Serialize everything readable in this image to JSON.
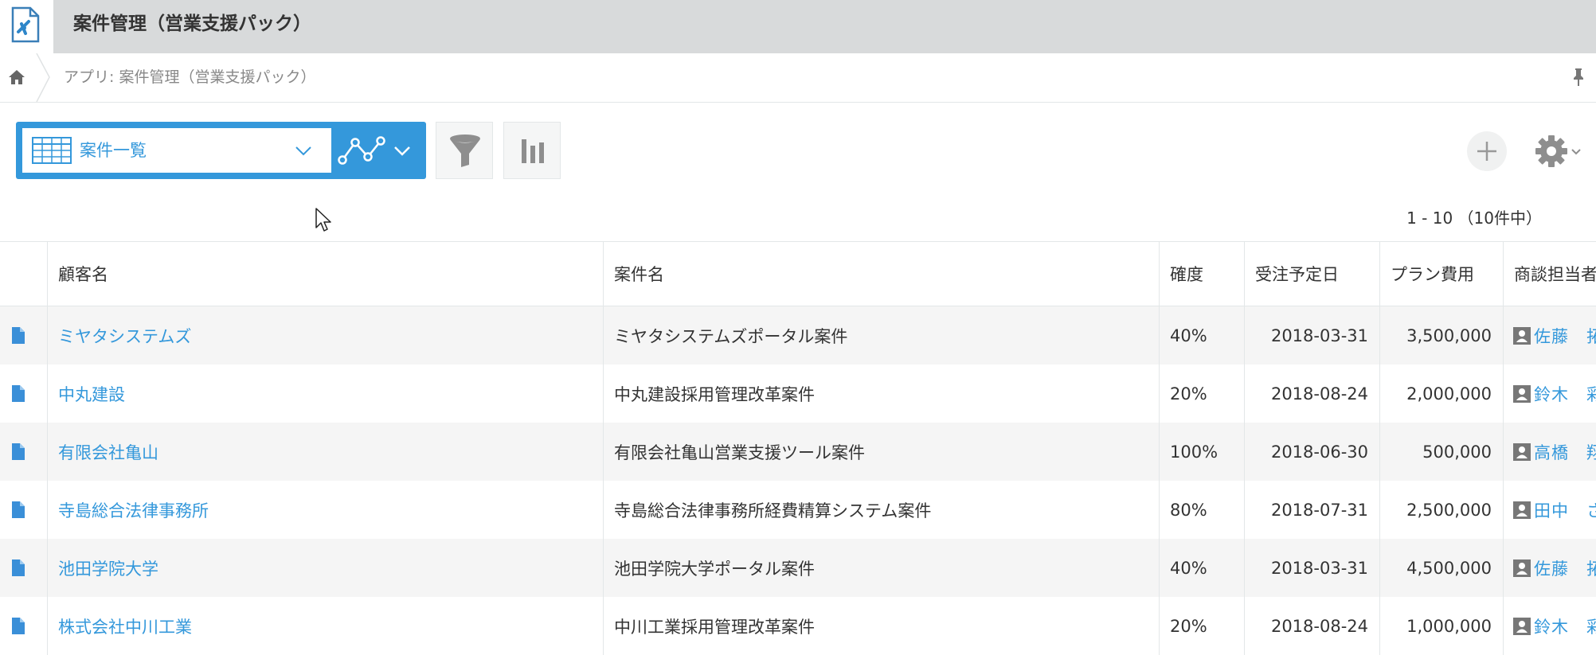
{
  "app": {
    "title": "案件管理（営業支援パック）"
  },
  "breadcrumb": {
    "text": "アプリ: 案件管理（営業支援パック）"
  },
  "toolbar": {
    "view_name": "案件一覧",
    "pagination": "1 - 10 （10件中）"
  },
  "table": {
    "headers": {
      "customer": "顧客名",
      "project": "案件名",
      "probability": "確度",
      "date": "受注予定日",
      "cost": "プラン費用",
      "owner": "商談担当者"
    },
    "rows": [
      {
        "customer": "ミヤタシステムズ",
        "project": "ミヤタシステムズポータル案件",
        "probability": "40%",
        "date": "2018-03-31",
        "cost": "3,500,000",
        "owner": "佐藤　拓哉"
      },
      {
        "customer": "中丸建設",
        "project": "中丸建設採用管理改革案件",
        "probability": "20%",
        "date": "2018-08-24",
        "cost": "2,000,000",
        "owner": "鈴木　彩"
      },
      {
        "customer": "有限会社亀山",
        "project": "有限会社亀山営業支援ツール案件",
        "probability": "100%",
        "date": "2018-06-30",
        "cost": "500,000",
        "owner": "高橋　翔太"
      },
      {
        "customer": "寺島総合法律事務所",
        "project": "寺島総合法律事務所経費精算システム案件",
        "probability": "80%",
        "date": "2018-07-31",
        "cost": "2,500,000",
        "owner": "田中　さくら"
      },
      {
        "customer": "池田学院大学",
        "project": "池田学院大学ポータル案件",
        "probability": "40%",
        "date": "2018-03-31",
        "cost": "4,500,000",
        "owner": "佐藤　拓哉"
      },
      {
        "customer": "株式会社中川工業",
        "project": "中川工業採用管理改革案件",
        "probability": "20%",
        "date": "2018-08-24",
        "cost": "1,000,000",
        "owner": "鈴木　彩"
      }
    ]
  },
  "colors": {
    "accent": "#3498db",
    "header_bg": "#d8dadb",
    "row_alt": "#f5f5f5"
  },
  "icons": {
    "app": "app-document-icon",
    "home": "home-icon",
    "pin": "pin-icon",
    "view": "table-view-icon",
    "graph": "graph-icon",
    "filter": "funnel-icon",
    "chart": "bar-chart-icon",
    "add": "plus-icon",
    "settings": "gear-icon",
    "record": "document-icon",
    "user": "user-icon"
  }
}
